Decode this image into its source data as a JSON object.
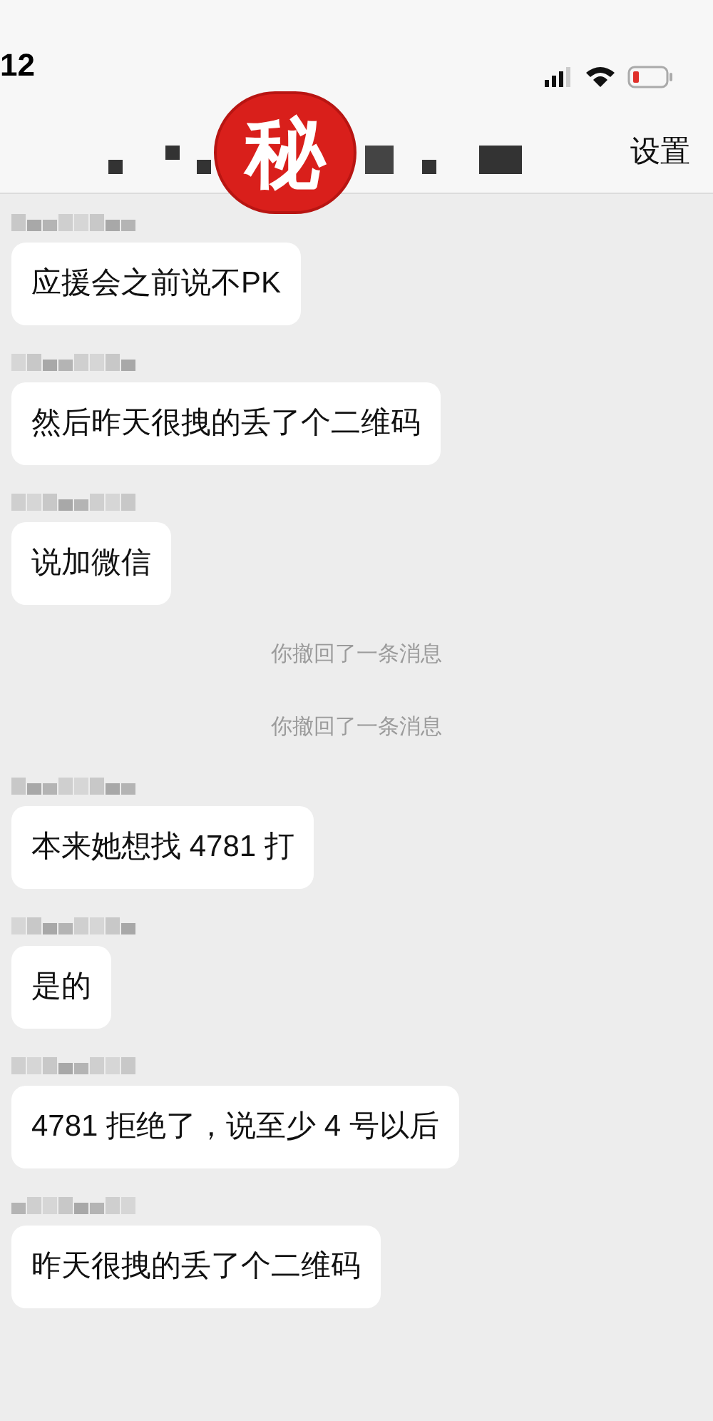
{
  "status_bar": {
    "time": "12"
  },
  "nav": {
    "sticker": "秘",
    "settings": "设置"
  },
  "messages": [
    {
      "kind": "message",
      "text": "应援会之前说不PK"
    },
    {
      "kind": "message",
      "text": "然后昨天很拽的丢了个二维码"
    },
    {
      "kind": "message",
      "text": "说加微信"
    },
    {
      "kind": "system",
      "text": "你撤回了一条消息"
    },
    {
      "kind": "system",
      "text": "你撤回了一条消息"
    },
    {
      "kind": "message",
      "text": "本来她想找 4781 打"
    },
    {
      "kind": "message",
      "text": "是的"
    },
    {
      "kind": "message",
      "text": "4781 拒绝了，说至少 4 号以后"
    },
    {
      "kind": "message",
      "text": "昨天很拽的丢了个二维码"
    }
  ]
}
